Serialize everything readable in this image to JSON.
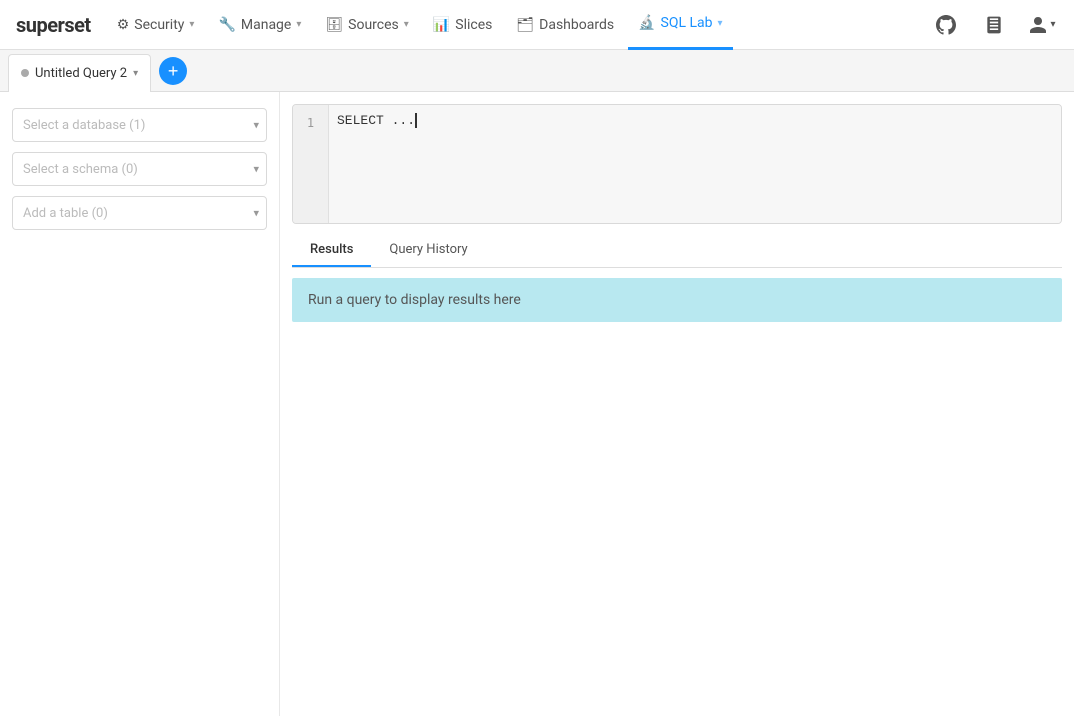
{
  "brand": "superset",
  "navbar": {
    "items": [
      {
        "id": "security",
        "label": "Security",
        "icon": "⚙",
        "hasDropdown": true,
        "active": false
      },
      {
        "id": "manage",
        "label": "Manage",
        "icon": "🔧",
        "hasDropdown": true,
        "active": false
      },
      {
        "id": "sources",
        "label": "Sources",
        "icon": "🗄",
        "hasDropdown": true,
        "active": false
      },
      {
        "id": "slices",
        "label": "Slices",
        "icon": "📊",
        "hasDropdown": false,
        "active": false
      },
      {
        "id": "dashboards",
        "label": "Dashboards",
        "icon": "🗂",
        "hasDropdown": false,
        "active": false
      },
      {
        "id": "sqllab",
        "label": "SQL Lab",
        "icon": "🔬",
        "hasDropdown": true,
        "active": true
      }
    ],
    "right": {
      "github_label": "GitHub",
      "book_label": "Docs",
      "user_label": "User"
    }
  },
  "tabs": {
    "query_tab_label": "Untitled Query 2",
    "add_tab_label": "+"
  },
  "left_panel": {
    "database_placeholder": "Select a database (1)",
    "schema_placeholder": "Select a schema (0)",
    "table_placeholder": "Add a table (0)"
  },
  "editor": {
    "line_numbers": [
      "1"
    ],
    "content": "SELECT ..."
  },
  "results": {
    "tabs": [
      {
        "id": "results",
        "label": "Results",
        "active": true
      },
      {
        "id": "query-history",
        "label": "Query History",
        "active": false
      }
    ],
    "placeholder": "Run a query to display results here"
  }
}
